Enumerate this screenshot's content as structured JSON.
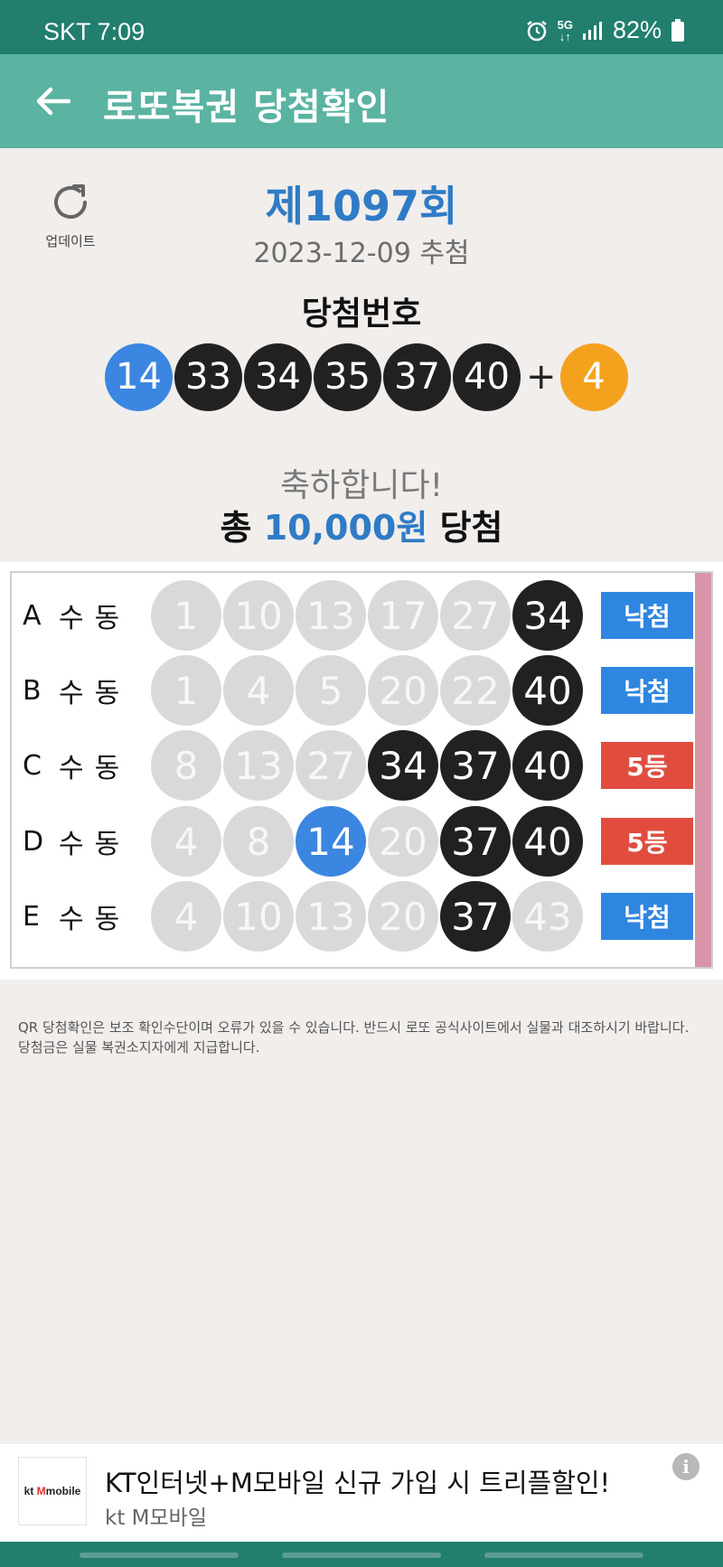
{
  "status": {
    "carrier": "SKT",
    "time": "7:09",
    "network_top": "5G",
    "network_bottom": "↓↑",
    "battery": "82%"
  },
  "app_bar": {
    "title": "로또복권 당첨확인"
  },
  "update_button": {
    "label": "업데이트"
  },
  "draw": {
    "round": "제1097회",
    "date": "2023-12-09 추첨",
    "winning_label": "당첨번호",
    "numbers": [
      "14",
      "33",
      "34",
      "35",
      "37",
      "40"
    ],
    "bonus": "4",
    "plus": "+"
  },
  "result": {
    "congrats": "축하합니다!",
    "prefix": "총",
    "amount": "10,000원",
    "suffix": "당첨"
  },
  "games": [
    {
      "id": "A",
      "mode": "수동",
      "numbers": [
        "1",
        "10",
        "13",
        "17",
        "27",
        "34"
      ],
      "result": "낙첨"
    },
    {
      "id": "B",
      "mode": "수동",
      "numbers": [
        "1",
        "4",
        "5",
        "20",
        "22",
        "40"
      ],
      "result": "낙첨"
    },
    {
      "id": "C",
      "mode": "수동",
      "numbers": [
        "8",
        "13",
        "27",
        "34",
        "37",
        "40"
      ],
      "result": "5등"
    },
    {
      "id": "D",
      "mode": "수동",
      "numbers": [
        "4",
        "8",
        "14",
        "20",
        "37",
        "40"
      ],
      "result": "5등"
    },
    {
      "id": "E",
      "mode": "수동",
      "numbers": [
        "4",
        "10",
        "13",
        "20",
        "37",
        "43"
      ],
      "result": "낙첨"
    }
  ],
  "disclaimer": "QR 당첨확인은 보조 확인수단이며 오류가 있을 수 있습니다. 반드시 로또 공식사이트에서 실물과 대조하시기 바랍니다. 당첨금은 실물 복권소지자에게 지급합니다.",
  "ad": {
    "logo_kt": "kt",
    "logo_m": "M",
    "logo_mobile": "mobile",
    "title": "KT인터넷+M모바일 신규 가입 시 트리플할인!",
    "subtitle": "kt M모바일",
    "info": "i"
  },
  "colors": {
    "status_bar": "#227e6e",
    "app_bar": "#5bb3a2",
    "matched_ball": "#212121",
    "first_ball": "#3b86e0",
    "bonus_ball": "#f4a21d",
    "unmatched_ball": "#d9d9d9",
    "lose_badge": "#2f86e0",
    "win_badge": "#e04d3f"
  }
}
